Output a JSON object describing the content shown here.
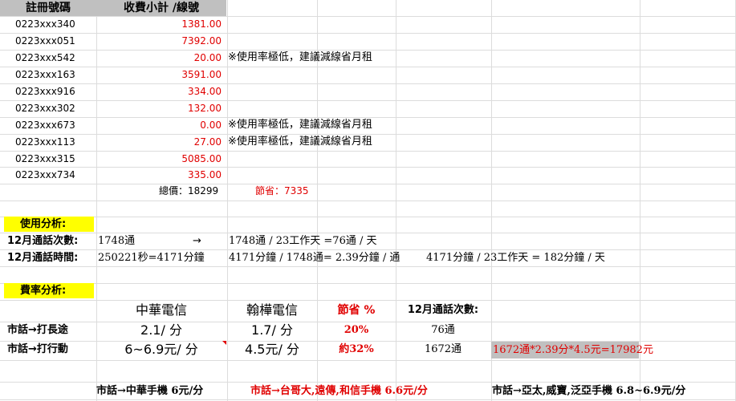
{
  "header": {
    "col_a": "註冊號碼",
    "col_b": "收費小計 /線號"
  },
  "lines": [
    {
      "number": "0223xxx340",
      "fee": "1381.00",
      "note": ""
    },
    {
      "number": "0223xxx051",
      "fee": "7392.00",
      "note": ""
    },
    {
      "number": "0223xxx542",
      "fee": "20.00",
      "note": "※使用率極低，建議減線省月租"
    },
    {
      "number": "0223xxx163",
      "fee": "3591.00",
      "note": ""
    },
    {
      "number": "0223xxx916",
      "fee": "334.00",
      "note": ""
    },
    {
      "number": "0223xxx302",
      "fee": "132.00",
      "note": ""
    },
    {
      "number": "0223xxx673",
      "fee": "0.00",
      "note": "※使用率極低，建議減線省月租"
    },
    {
      "number": "0223xxx113",
      "fee": "27.00",
      "note": "※使用率極低，建議減線省月租"
    },
    {
      "number": "0223xxx315",
      "fee": "5085.00",
      "note": ""
    },
    {
      "number": "0223xxx734",
      "fee": "335.00",
      "note": ""
    }
  ],
  "totals": {
    "total": "總價：18299",
    "saving": "節省：7335"
  },
  "usage": {
    "title": "使用分析:",
    "calls_label": "12月通話次數:",
    "calls_value": "1748通",
    "arrow": "→",
    "calls_calc": "1748通 / 23工作天 =76通 / 天",
    "time_label": "12月通話時間:",
    "time_value": "250221秒=4171分鐘",
    "time_calc_1": "4171分鐘 / 1748通= 2.39分鐘 / 通",
    "time_calc_2": "4171分鐘 /  23工作天 = 182分鐘 / 天"
  },
  "rates": {
    "title": "費率分析:",
    "col_cht": "中華電信",
    "col_hanlin": "翰樺電信",
    "col_saving": "節省 %",
    "col_calls": "12月通話次數:",
    "row1": {
      "label": "市話→打長途",
      "cht": "2.1/ 分",
      "hanlin": "1.7/ 分",
      "saving": "20%",
      "calls": "76通"
    },
    "row2": {
      "label": "市話→打行動",
      "cht": "6~6.9元/ 分",
      "hanlin": "4.5元/ 分",
      "saving": "約32%",
      "calls": "1672通",
      "calc": "1672通*2.39分*4.5元=17982元"
    }
  },
  "footer": {
    "item1": "市話→中華手機 6元/分",
    "item2": "市話→台哥大,遠傳,和信手機 6.6元/分",
    "item3": "市話→亞太,威寶,泛亞手機 6.8~6.9元/分"
  },
  "colors": {
    "header_bg": "#c0c0c0",
    "highlight": "#ffff00",
    "red": "#e00000",
    "grid": "#dcdcdc"
  }
}
